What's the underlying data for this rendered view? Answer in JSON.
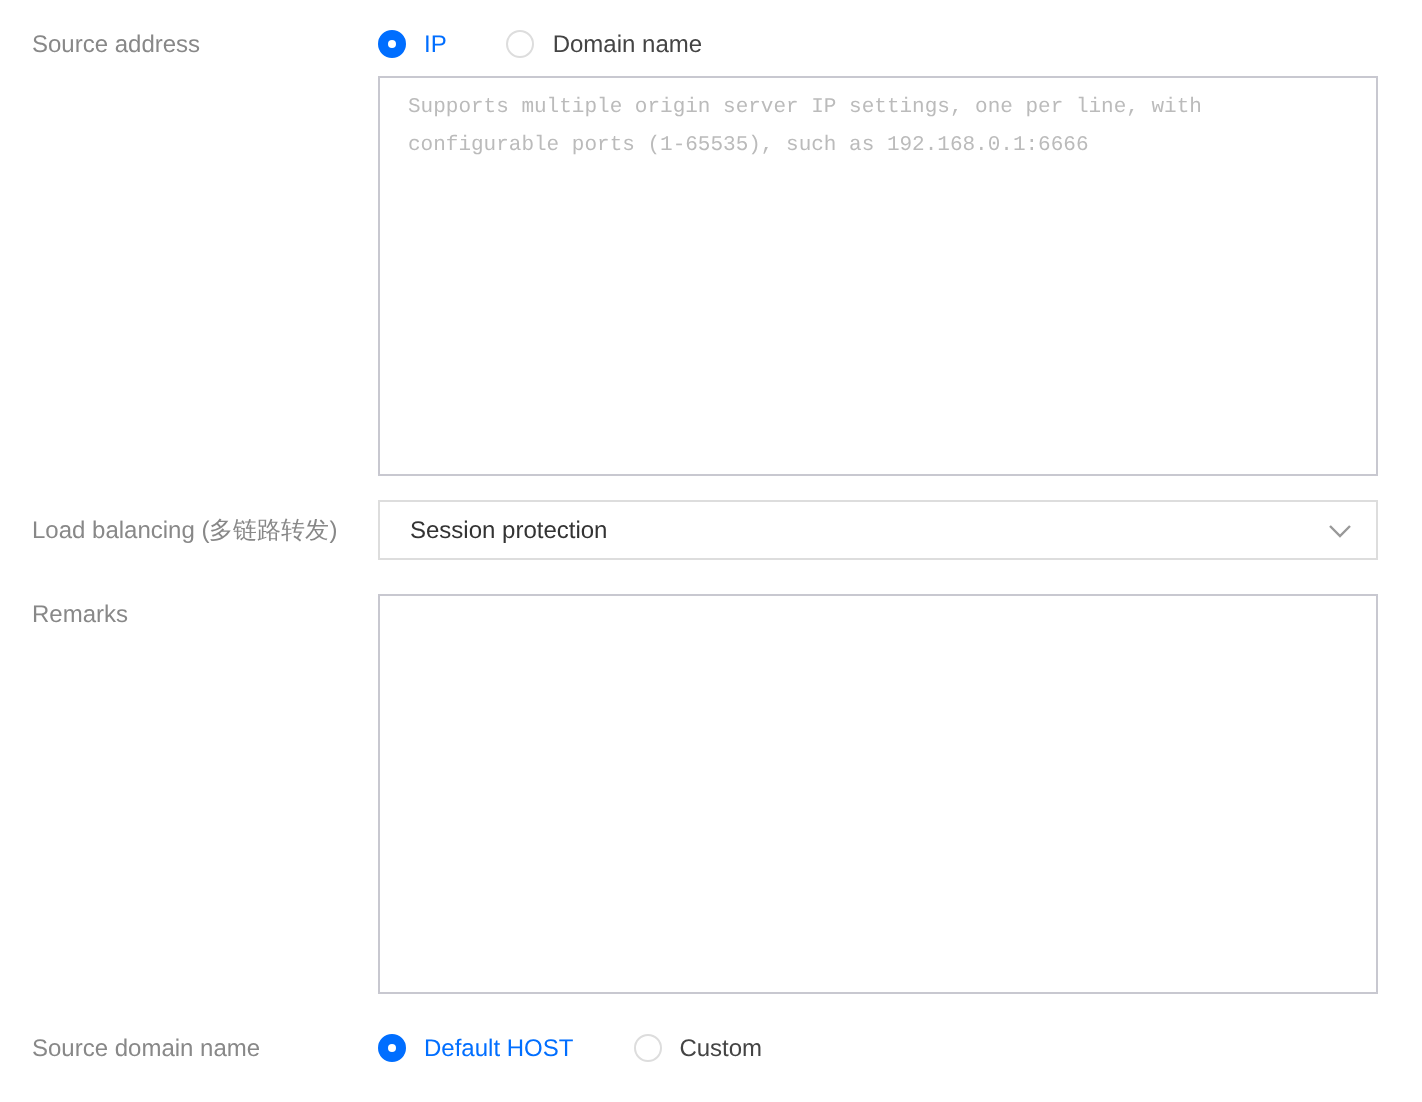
{
  "form": [
    {
      "label": "Source address",
      "controls": [
        {
          "kind": "radio",
          "options": [
            {
              "label": "IP",
              "selected": true
            },
            {
              "label": "Domain name",
              "selected": false
            }
          ]
        },
        {
          "kind": "textarea",
          "placeholder": "Supports multiple origin server IP settings, one per line, with configurable ports (1-65535), such as 192.168.0.1:6666"
        }
      ]
    },
    {
      "label": "Load balancing (多链路转发)",
      "controls": [
        {
          "kind": "select",
          "value": "Session protection"
        }
      ]
    },
    {
      "label": "Remarks",
      "controls": [
        {
          "kind": "textarea"
        }
      ]
    },
    {
      "label": "Source domain name",
      "controls": [
        {
          "kind": "radio",
          "options": [
            {
              "label": "Default HOST",
              "selected": true
            },
            {
              "label": "Custom",
              "selected": false
            }
          ]
        }
      ]
    }
  ]
}
